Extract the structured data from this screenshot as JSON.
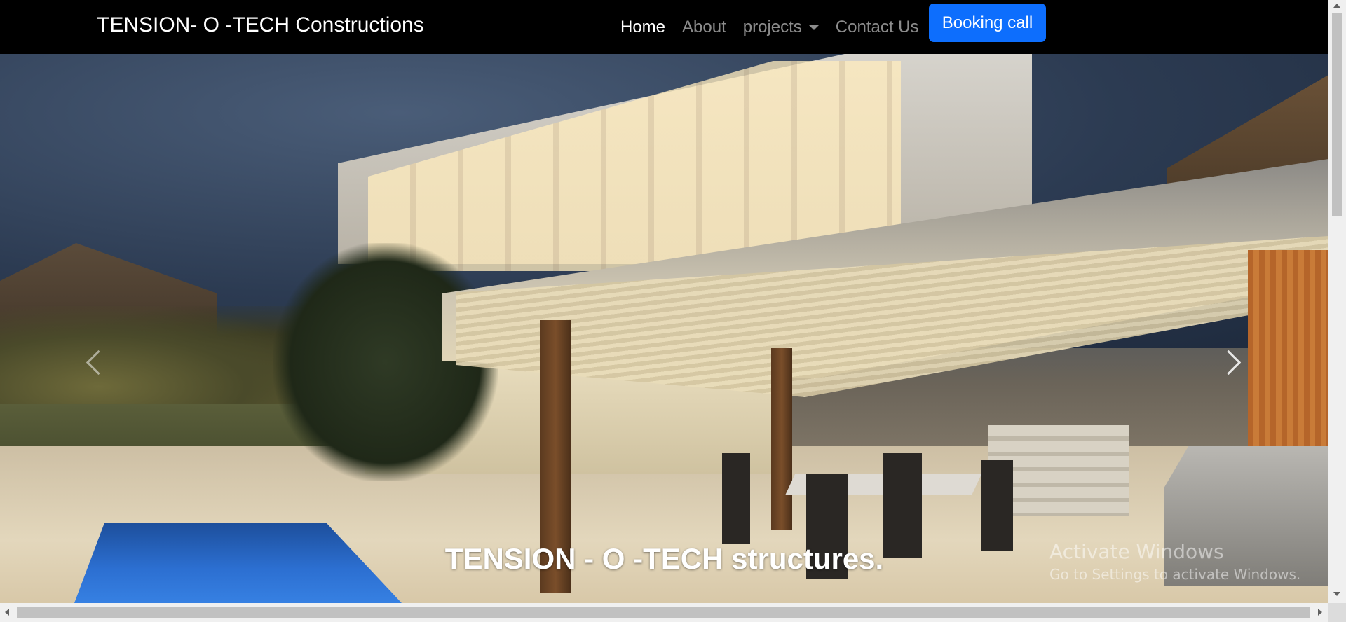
{
  "navbar": {
    "brand": "TENSION- O -TECH Constructions",
    "links": [
      {
        "label": "Home",
        "active": true
      },
      {
        "label": "About",
        "active": false
      },
      {
        "label": "projects",
        "active": false,
        "dropdown": true
      },
      {
        "label": "Contact Us",
        "active": false
      }
    ],
    "cta": "Booking call",
    "cta_color": "#0d6efd"
  },
  "hero": {
    "caption": "TENSION - O -TECH structures.",
    "controls": {
      "prev_icon": "chevron-left-icon",
      "next_icon": "chevron-right-icon"
    }
  },
  "watermark": {
    "title": "Activate Windows",
    "subtitle": "Go to Settings to activate Windows."
  }
}
